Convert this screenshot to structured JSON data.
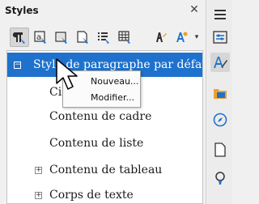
{
  "panel": {
    "title": "Styles",
    "close_symbol": "✕"
  },
  "toolbar": {
    "icons": [
      "paragraph-styles-icon",
      "character-styles-icon",
      "frame-styles-icon",
      "page-styles-icon",
      "list-styles-icon",
      "table-styles-icon",
      "fill-format-mode-icon",
      "new-style-from-selection-icon"
    ],
    "dropdown_symbol": "▾"
  },
  "style_list": {
    "items": [
      {
        "label": "Style de paragraphe par défaut",
        "expander": "−",
        "selected": true
      },
      {
        "label": "Ci",
        "expander": "",
        "selected": false
      },
      {
        "label": "Contenu de cadre",
        "expander": "",
        "selected": false
      },
      {
        "label": "Contenu de liste",
        "expander": "",
        "selected": false
      },
      {
        "label": "Contenu de tableau",
        "expander": "+",
        "selected": false
      },
      {
        "label": "Corps de texte",
        "expander": "+",
        "selected": false
      }
    ]
  },
  "context_menu": {
    "items": [
      {
        "label": "Nouveau..."
      },
      {
        "label": "Modifier..."
      }
    ]
  },
  "sidebar": {
    "items": [
      "menu-icon",
      "properties-icon",
      "styles-icon",
      "gallery-icon",
      "navigator-icon",
      "page-icon",
      "style-inspector-icon"
    ]
  },
  "colors": {
    "selection": "#1e72cd",
    "accent_orange": "#f0a030",
    "icon_blue": "#1e72cd"
  }
}
